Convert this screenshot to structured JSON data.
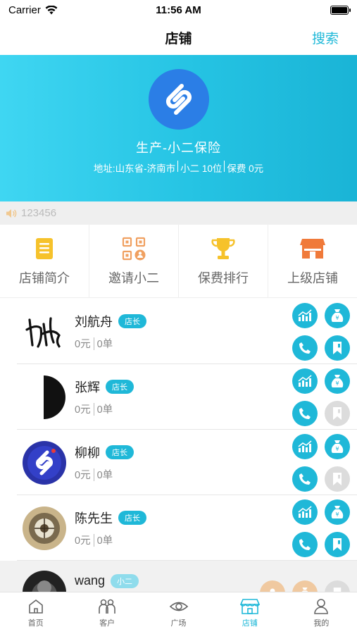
{
  "status": {
    "carrier": "Carrier",
    "time": "11:56 AM"
  },
  "navbar": {
    "title": "店铺",
    "search_label": "搜索"
  },
  "shop": {
    "name": "生产-小二保险",
    "address": "地址:山东省-济南市",
    "members": "小二 10位",
    "premium": "保费 0元"
  },
  "notice": {
    "text": "123456"
  },
  "menu": [
    {
      "label": "店铺简介",
      "icon": "document-icon"
    },
    {
      "label": "邀请小二",
      "icon": "qrcode-icon"
    },
    {
      "label": "保费排行",
      "icon": "trophy-icon"
    },
    {
      "label": "上级店铺",
      "icon": "store-icon"
    }
  ],
  "members": [
    {
      "name": "刘航舟",
      "tag": "店长",
      "amount": "0元",
      "orders": "0单",
      "call_enabled": true,
      "bookmark_enabled": true
    },
    {
      "name": "张辉",
      "tag": "店长",
      "amount": "0元",
      "orders": "0单",
      "call_enabled": true,
      "bookmark_enabled": false
    },
    {
      "name": "柳柳",
      "tag": "店长",
      "amount": "0元",
      "orders": "0单",
      "call_enabled": true,
      "bookmark_enabled": false
    },
    {
      "name": "陈先生",
      "tag": "店长",
      "amount": "0元",
      "orders": "0单",
      "call_enabled": true,
      "bookmark_enabled": true
    },
    {
      "name": "wang",
      "tag": "小二"
    }
  ],
  "tabbar": [
    {
      "label": "首页",
      "icon": "home-icon"
    },
    {
      "label": "客户",
      "icon": "customers-icon"
    },
    {
      "label": "广场",
      "icon": "eye-icon"
    },
    {
      "label": "店铺",
      "icon": "store-icon",
      "active": true
    },
    {
      "label": "我的",
      "icon": "profile-icon"
    }
  ],
  "colors": {
    "accent": "#1fb8d8",
    "banner": "#25c3e3",
    "logo": "#2b7ee6"
  }
}
